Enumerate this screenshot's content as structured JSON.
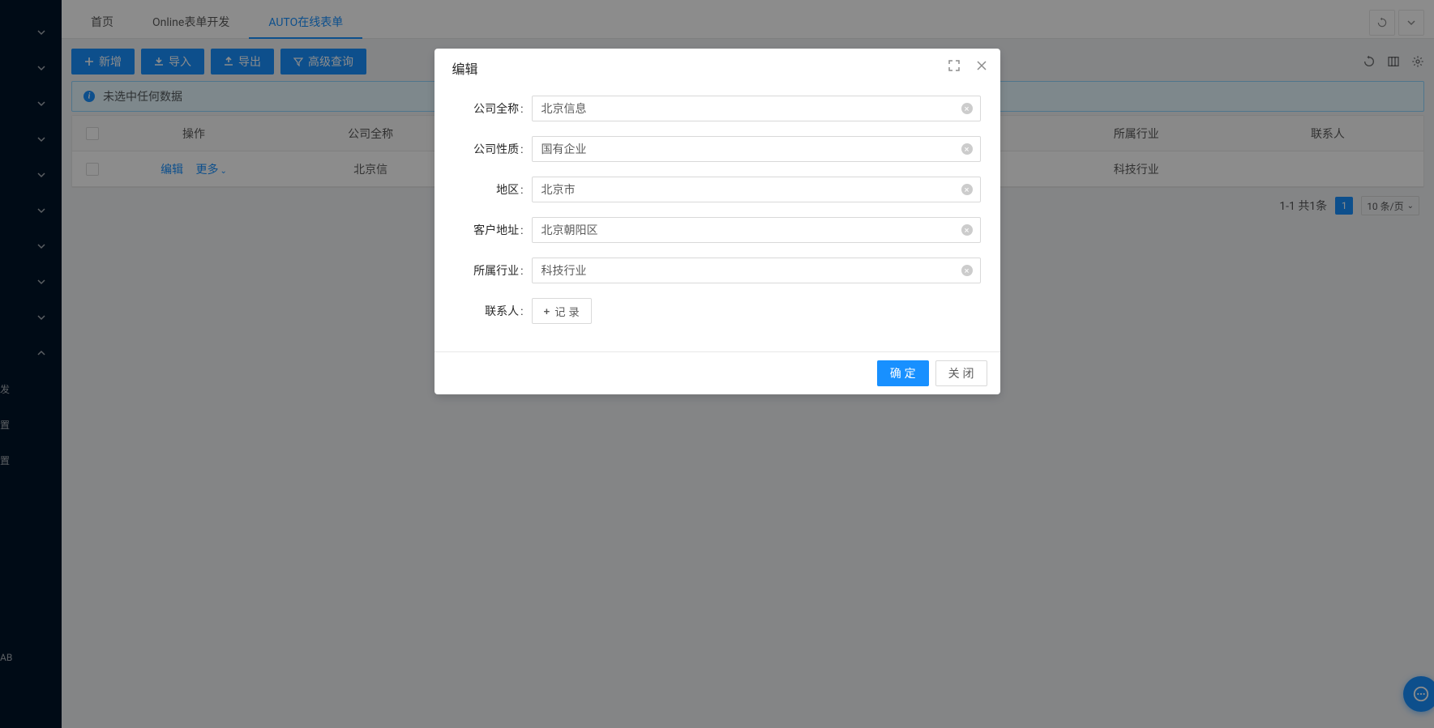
{
  "sidebar": {
    "sub_items": [
      "发",
      "置",
      "置",
      "AB"
    ]
  },
  "tabs": {
    "items": [
      "首页",
      "Online表单开发",
      "AUTO在线表单"
    ],
    "active_index": 2
  },
  "toolbar": {
    "new": "新增",
    "import": "导入",
    "export": "导出",
    "advanced": "高级查询"
  },
  "alert": {
    "text": "未选中任何数据"
  },
  "table": {
    "headers": [
      "操作",
      "公司全称",
      "所属行业",
      "联系人"
    ],
    "row": {
      "edit": "编辑",
      "more": "更多",
      "company": "北京信",
      "industry": "科技行业",
      "contact": ""
    }
  },
  "pagination": {
    "summary": "1-1 共1条",
    "page": "1",
    "size": "10 条/页"
  },
  "modal": {
    "title": "编辑",
    "fields": {
      "company_name": {
        "label": "公司全称",
        "value": "北京信息"
      },
      "company_nature": {
        "label": "公司性质",
        "value": "国有企业"
      },
      "region": {
        "label": "地区",
        "value": "北京市"
      },
      "address": {
        "label": "客户地址",
        "value": "北京朝阳区"
      },
      "industry": {
        "label": "所属行业",
        "value": "科技行业"
      },
      "contact": {
        "label": "联系人",
        "button": "记 录"
      }
    },
    "ok": "确 定",
    "cancel": "关 闭"
  }
}
